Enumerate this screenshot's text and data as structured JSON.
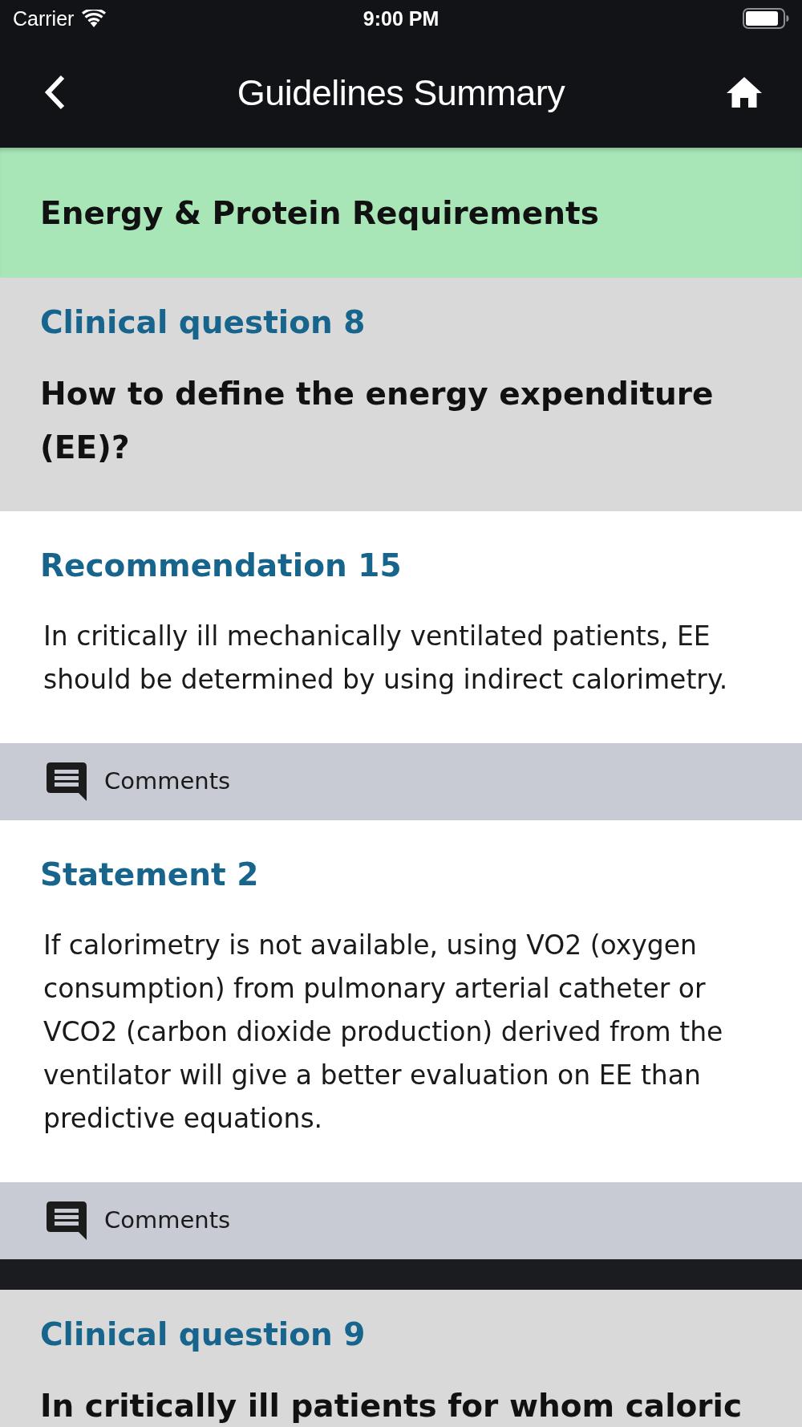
{
  "status_bar": {
    "carrier": "Carrier",
    "time": "9:00 PM"
  },
  "nav_bar": {
    "title": "Guidelines Summary"
  },
  "section_header": {
    "title": "Energy & Protein Requirements"
  },
  "questions": [
    {
      "label": "Clinical question 8",
      "text": "How to define the energy expenditure (EE)?",
      "items": [
        {
          "label": "Recommendation 15",
          "text": "In critically ill mechanically ventilated patients, EE should be determined by using indirect calorimetry.",
          "comments": "Comments"
        },
        {
          "label": "Statement 2",
          "text": "If calorimetry is not available, using VO2 (oxygen consumption) from pulmonary arterial catheter or VCO2 (carbon dioxide production) derived from the ventilator will give a better evaluation on EE than predictive equations.",
          "comments": "Comments"
        }
      ]
    },
    {
      "label": "Clinical question 9",
      "text": "In critically ill patients for whom caloric"
    }
  ]
}
